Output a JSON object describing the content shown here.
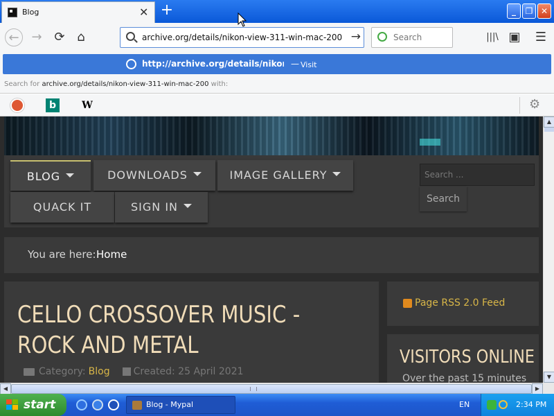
{
  "browser": {
    "tab": {
      "title": "Blog"
    },
    "new_tab": "+",
    "window_buttons": {
      "minimize": "_",
      "maximize": "❐",
      "close": "✕"
    },
    "nav": {
      "back": "←",
      "forward": "→",
      "reload": "⟳",
      "home": "⌂"
    },
    "url": "archive.org/details/nikon-view-311-win-mac-200",
    "go": "→",
    "search_placeholder": "Search",
    "toolbar_icons": [
      "library-icon",
      "sidebar-icon",
      "menu-icon"
    ],
    "menu_glyph": "☰",
    "library_glyph": "|||\\",
    "sidebar_glyph": "▣"
  },
  "url_popup": {
    "visit_url": "http://archive.org/details/nikon",
    "dash": "—",
    "visit_label": "Visit",
    "search_for_prefix": "Search for",
    "search_for_query": "archive.org/details/nikon-view-311-win-mac-200",
    "search_for_suffix": "with:",
    "engines": [
      "duckduckgo-icon",
      "bing-icon",
      "wikipedia-icon"
    ],
    "bing_glyph": "b",
    "wiki_glyph": "W",
    "settings_glyph": "⚙"
  },
  "site": {
    "menu": {
      "blog": "BLOG",
      "downloads": "DOWNLOADS",
      "image_gallery": "IMAGE GALLERY",
      "quack_it": "QUACK IT",
      "sign_in": "SIGN IN"
    },
    "search_placeholder": "Search ...",
    "search_button": "Search",
    "breadcrumb": {
      "label": "You are here:",
      "current": "Home"
    },
    "article": {
      "title": "CELLO CROSSOVER MUSIC - ROCK AND METAL",
      "category_label": "Category:",
      "category": "Blog",
      "created": "Created: 25 April 2021"
    },
    "sidebar": {
      "rss": "Page RSS 2.0 Feed",
      "visitors_title": "VISITORS ONLINE",
      "visitors_sub": "Over the past 15 minutes"
    }
  },
  "taskbar": {
    "start": "start",
    "window": "Blog - Mypal",
    "language": "EN",
    "clock": "2:34 PM"
  }
}
